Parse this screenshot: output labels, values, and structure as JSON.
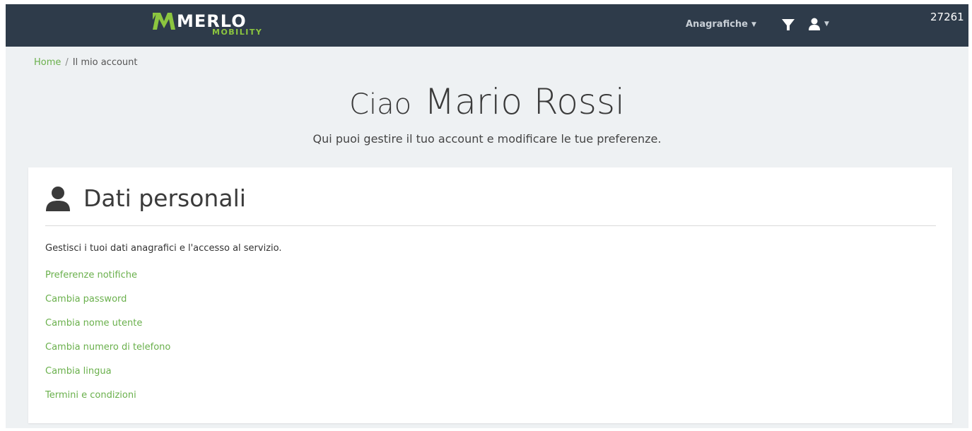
{
  "brand": {
    "name": "MERLO",
    "sub": "MOBILITY",
    "color_primary": "#8cc63f"
  },
  "navbar": {
    "background": "#2e3b4a",
    "menu_label": "Anagrafiche",
    "filter_icon": "filter-icon",
    "user_icon": "user-icon",
    "code": "27261"
  },
  "breadcrumb": {
    "home": "Home",
    "separator": "/",
    "current": "Il mio account"
  },
  "header": {
    "greeting": "Ciao",
    "name": "Mario Rossi",
    "subtitle": "Qui puoi gestire il tuo account e modificare le tue preferenze."
  },
  "card": {
    "icon": "user-icon",
    "title": "Dati personali",
    "description": "Gestisci i tuoi dati anagrafici e l'accesso al servizio.",
    "links": [
      {
        "label": "Preferenze notifiche"
      },
      {
        "label": "Cambia password"
      },
      {
        "label": "Cambia nome utente"
      },
      {
        "label": "Cambia numero di telefono"
      },
      {
        "label": "Cambia lingua"
      },
      {
        "label": "Termini e condizioni"
      }
    ]
  }
}
